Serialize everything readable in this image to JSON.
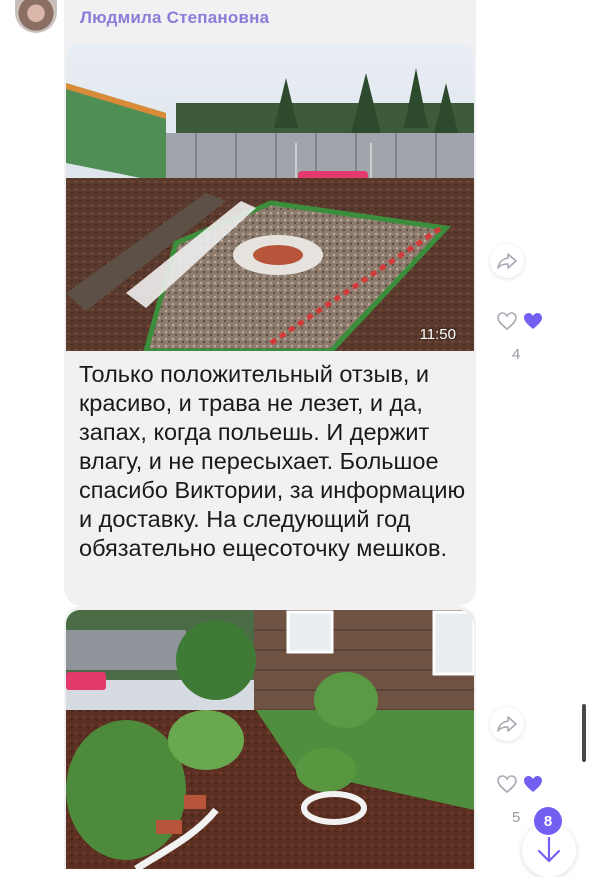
{
  "message1": {
    "sender": "Людмила Степановна",
    "time": "11:50",
    "text": "Только положительный отзыв, и красиво, и трава не лезет, и да, запах, когда польешь. И держит влагу, и не пересыхает. Большое спасибо Виктории, за информацию и доставку. На следующий год обязательно ещесоточку мешков.",
    "like_count": "4"
  },
  "message2": {
    "like_count": "5"
  },
  "unread_count": "8",
  "colors": {
    "accent": "#7360f2",
    "sender_name": "#8c7cd8",
    "bubble": "#f1f1f3"
  },
  "icons": {
    "share": "share-icon",
    "heart_outline": "heart-outline-icon",
    "heart_filled": "heart-filled-icon",
    "arrow_down": "arrow-down-icon"
  }
}
